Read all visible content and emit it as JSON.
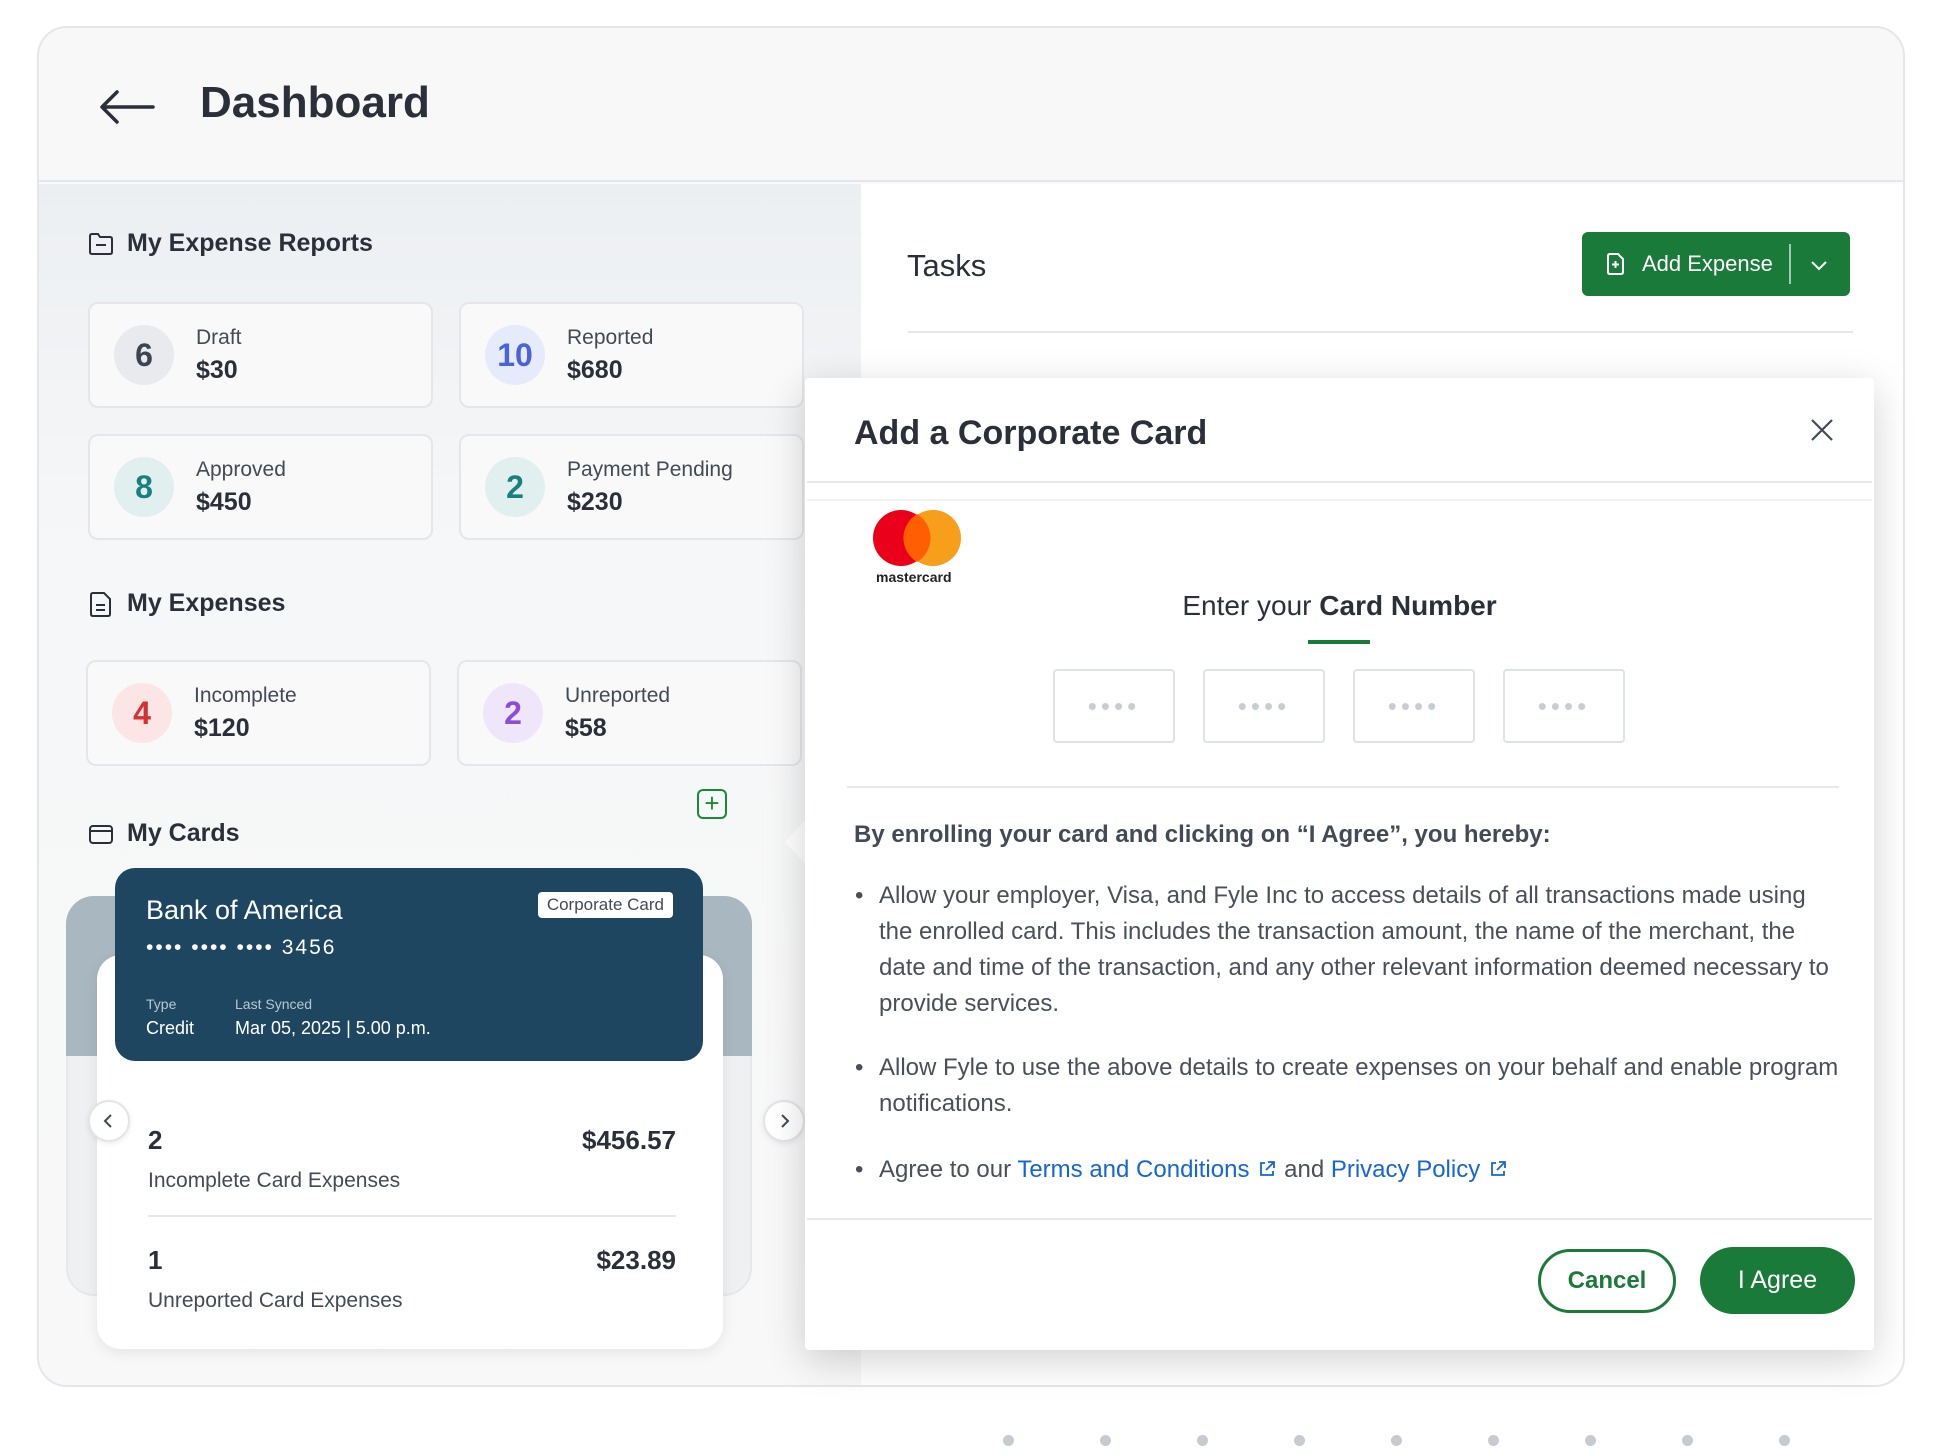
{
  "header": {
    "title": "Dashboard"
  },
  "expense_reports": {
    "title": "My Expense Reports",
    "items": [
      {
        "count": "6",
        "label": "Draft",
        "amount": "$30",
        "color": "#3d4350",
        "bg": "#e8eaed"
      },
      {
        "count": "10",
        "label": "Reported",
        "amount": "$680",
        "color": "#4a63d9",
        "bg": "#e6ebfb"
      },
      {
        "count": "8",
        "label": "Approved",
        "amount": "$450",
        "color": "#1b7f80",
        "bg": "#e1f0ef"
      },
      {
        "count": "2",
        "label": "Payment Pending",
        "amount": "$230",
        "color": "#1b7f80",
        "bg": "#e1f0ef"
      }
    ]
  },
  "expenses": {
    "title": "My Expenses",
    "items": [
      {
        "count": "4",
        "label": "Incomplete",
        "amount": "$120",
        "color": "#d63131",
        "bg": "#fbe5e5"
      },
      {
        "count": "2",
        "label": "Unreported",
        "amount": "$58",
        "color": "#8a4fd6",
        "bg": "#efe6fb"
      }
    ]
  },
  "cards": {
    "title": "My Cards",
    "card": {
      "bank": "Bank of America",
      "tag": "Corporate Card",
      "number": "•••• •••• •••• 3456",
      "type_label": "Type",
      "type_value": "Credit",
      "synced_label": "Last Synced",
      "synced_value": "Mar 05, 2025 | 5.00 p.m."
    },
    "rows": [
      {
        "count": "2",
        "amount": "$456.57",
        "label": "Incomplete Card Expenses"
      },
      {
        "count": "1",
        "amount": "$23.89",
        "label": "Unreported Card Expenses"
      }
    ]
  },
  "tasks": {
    "title": "Tasks",
    "add_expense_label": "Add Expense"
  },
  "modal": {
    "title": "Add a Corporate Card",
    "logo_text": "mastercard",
    "enter_prefix": "Enter your ",
    "enter_bold": "Card Number",
    "digit_placeholder": "••••",
    "consent_head": "By enrolling your card and clicking on “I Agree”, you hereby:",
    "bullet1": "Allow your employer, Visa, and Fyle Inc to access details of all transactions made using the enrolled card. This includes the transaction amount, the name of the merchant, the date and time of the transaction, and any other relevant information deemed necessary to provide services.",
    "bullet2": "Allow Fyle to use the above details to create expenses on your behalf and enable program notifications.",
    "bullet3_prefix": "Agree to our ",
    "terms_link": "Terms and Conditions",
    "and_text": "and",
    "privacy_link": "Privacy Policy",
    "cancel_label": "Cancel",
    "agree_label": "I Agree"
  },
  "colors": {
    "accent": "#1a7a3a",
    "card_bg": "#1f4660",
    "link": "#1565d8"
  }
}
